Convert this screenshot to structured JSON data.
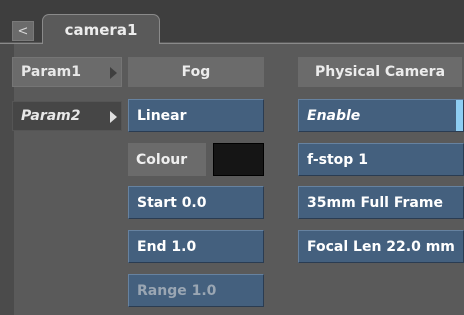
{
  "tab": {
    "back_label": "<",
    "title": "camera1"
  },
  "params": [
    {
      "label": "Param1"
    },
    {
      "label": "Param2"
    }
  ],
  "fog": {
    "header": "Fog",
    "mode": "Linear",
    "colour_label": "Colour",
    "colour_value": "#151515",
    "start": "Start 0.0",
    "end": "End 1.0",
    "range": "Range 1.0"
  },
  "camera": {
    "header": "Physical Camera",
    "enable": "Enable",
    "fstop": "f-stop 1",
    "format": "35mm Full Frame",
    "focal": "Focal Len 22.0 mm"
  },
  "colors": {
    "button_blue": "#44607e",
    "enable_indicator": "#8ecdf2",
    "panel": "#5a5a5a"
  }
}
